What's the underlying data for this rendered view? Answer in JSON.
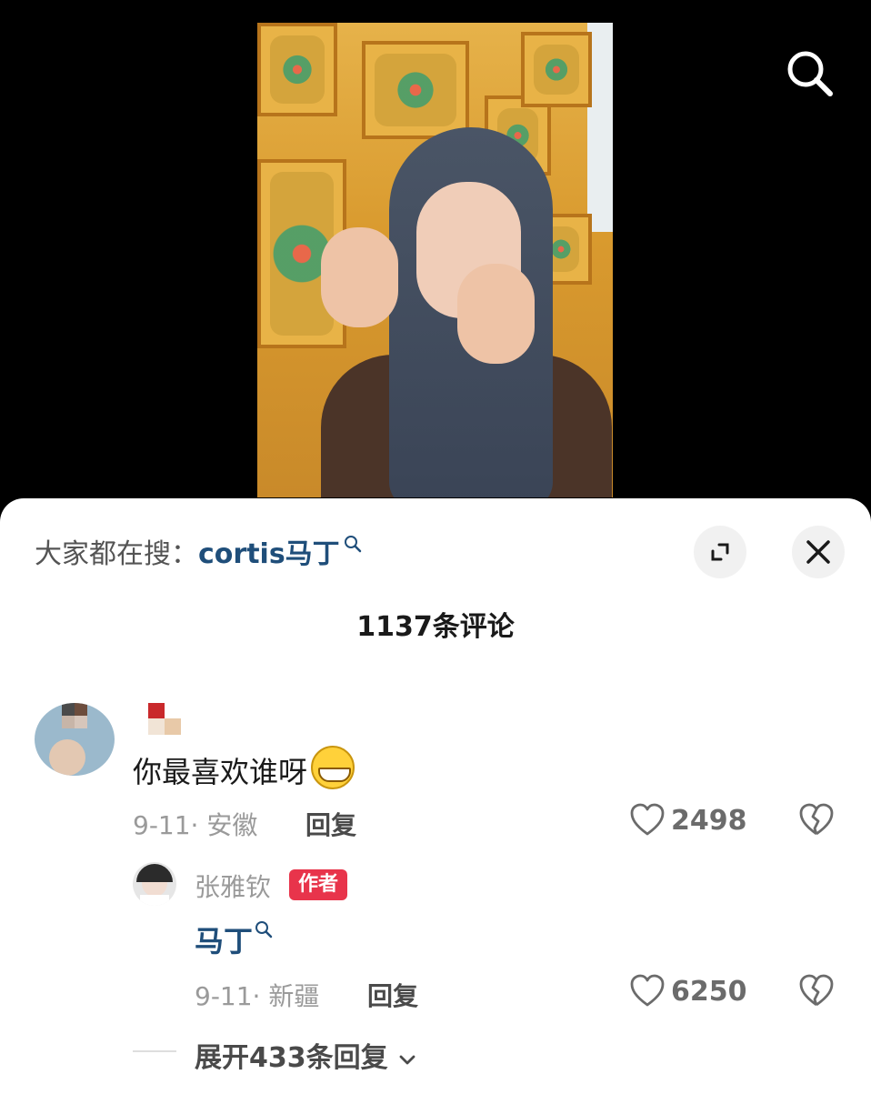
{
  "header": {
    "search_icon": "search-icon"
  },
  "panel": {
    "hot_search_prefix": "大家都在搜：",
    "hot_search_term": "cortis马丁",
    "comment_count_text": "1137条评论"
  },
  "comments": [
    {
      "body": "你最喜欢谁呀",
      "emoji": "grinning-face-emoji",
      "date": "9-11",
      "location": "· 安徽",
      "reply_label": "回复",
      "likes": "2498",
      "replies": [
        {
          "author": "张雅钦",
          "badge": "作者",
          "body": "马丁",
          "date": "9-11",
          "location": "· 新疆",
          "reply_label": "回复",
          "likes": "6250"
        }
      ],
      "expand_label": "展开433条回复"
    }
  ]
}
